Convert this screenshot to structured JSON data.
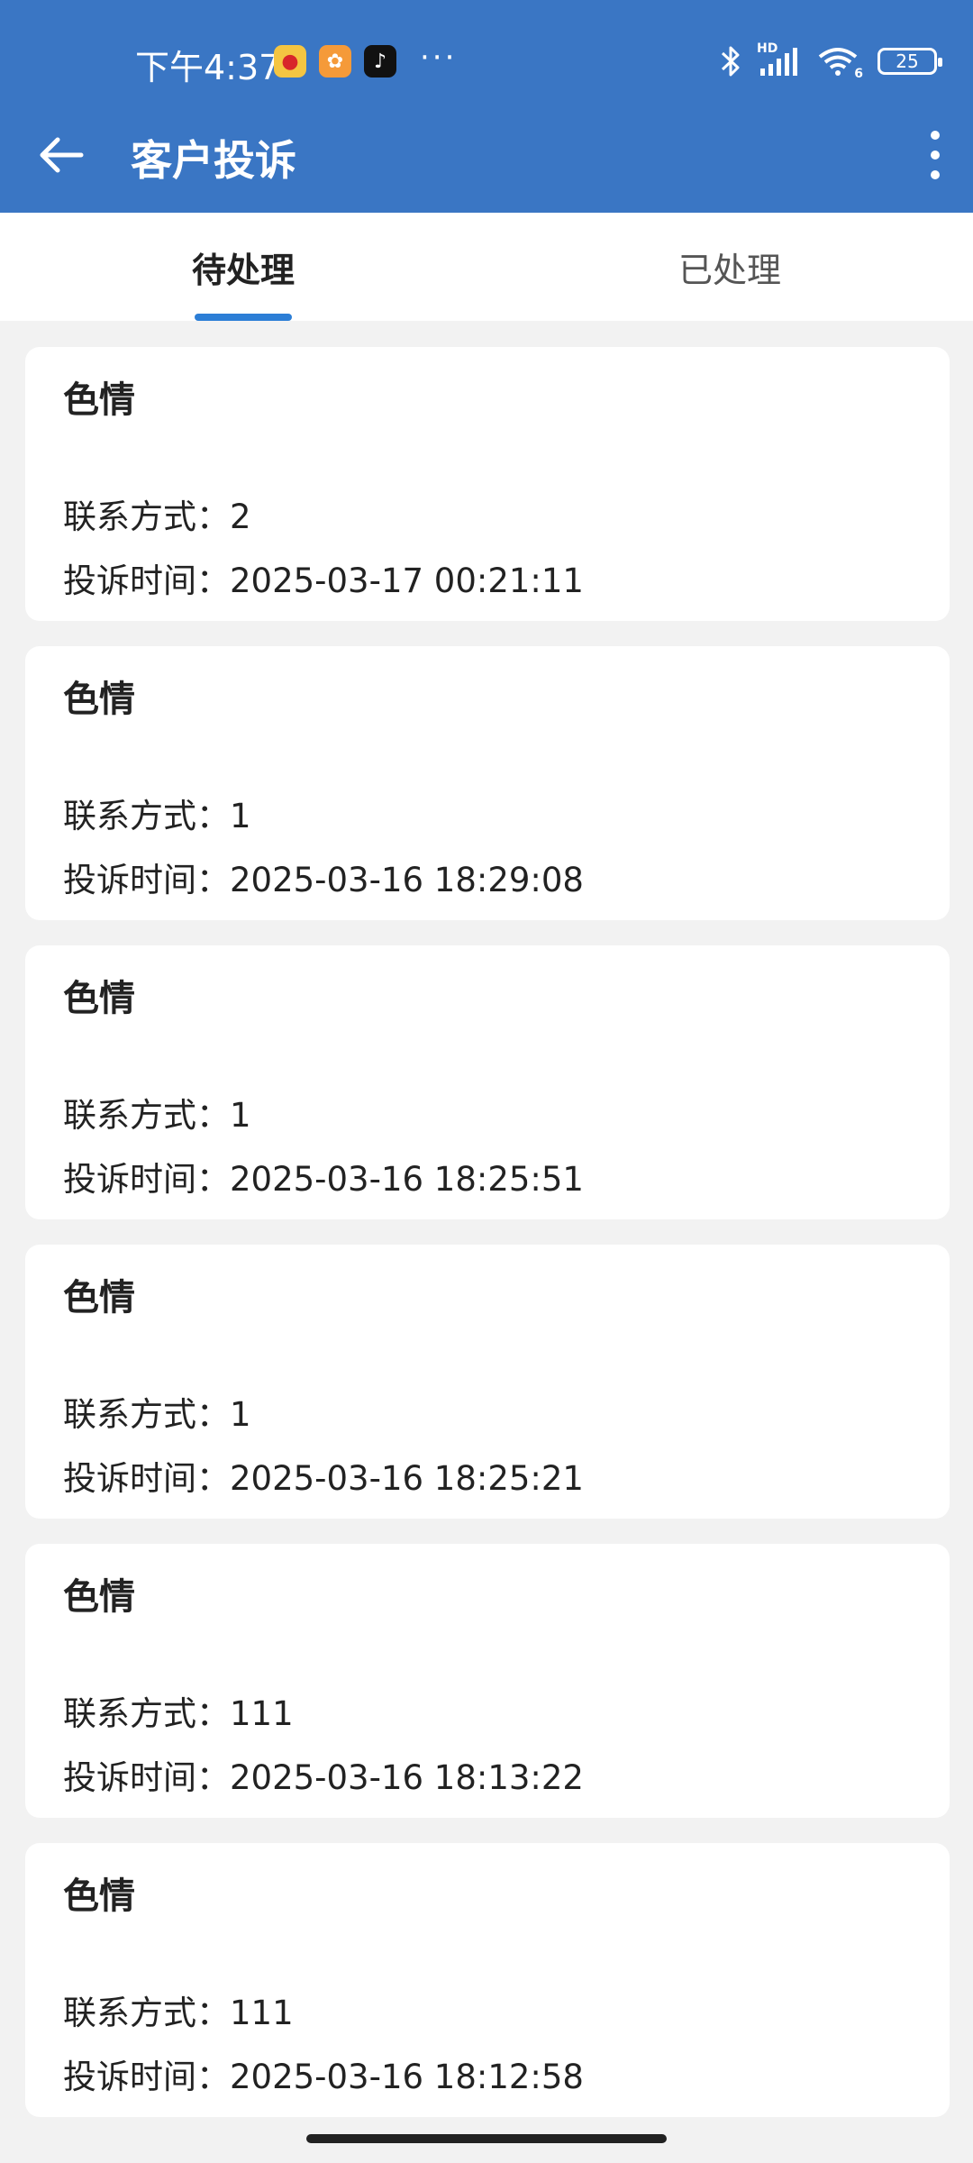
{
  "status_bar": {
    "time": "下午4:37",
    "app_icons": [
      "weibo-icon",
      "xiaohongshu-icon",
      "tiktok-icon"
    ],
    "more": "···",
    "network_label": "HD",
    "wifi_sub": "6",
    "battery": "25"
  },
  "app_bar": {
    "title": "客户投诉",
    "back_icon": "arrow-left-icon",
    "menu_icon": "more-vertical-icon"
  },
  "tabs": [
    {
      "label": "待处理",
      "active": true
    },
    {
      "label": "已处理",
      "active": false
    }
  ],
  "complaints": [
    {
      "title": "色情",
      "contact_label": "联系方式：",
      "contact": "2",
      "time_label": "投诉时间：",
      "time": "2025-03-17 00:21:11"
    },
    {
      "title": "色情",
      "contact_label": "联系方式：",
      "contact": "1",
      "time_label": "投诉时间：",
      "time": "2025-03-16 18:29:08"
    },
    {
      "title": "色情",
      "contact_label": "联系方式：",
      "contact": "1",
      "time_label": "投诉时间：",
      "time": "2025-03-16 18:25:51"
    },
    {
      "title": "色情",
      "contact_label": "联系方式：",
      "contact": "1",
      "time_label": "投诉时间：",
      "time": "2025-03-16 18:25:21"
    },
    {
      "title": "色情",
      "contact_label": "联系方式：",
      "contact": "111",
      "time_label": "投诉时间：",
      "time": "2025-03-16 18:13:22"
    },
    {
      "title": "色情",
      "contact_label": "联系方式：",
      "contact": "111",
      "time_label": "投诉时间：",
      "time": "2025-03-16 18:12:58"
    }
  ],
  "colors": {
    "primary": "#3a76c4",
    "tab_indicator": "#2c7ed6",
    "background": "#f2f2f2",
    "card": "#ffffff"
  }
}
